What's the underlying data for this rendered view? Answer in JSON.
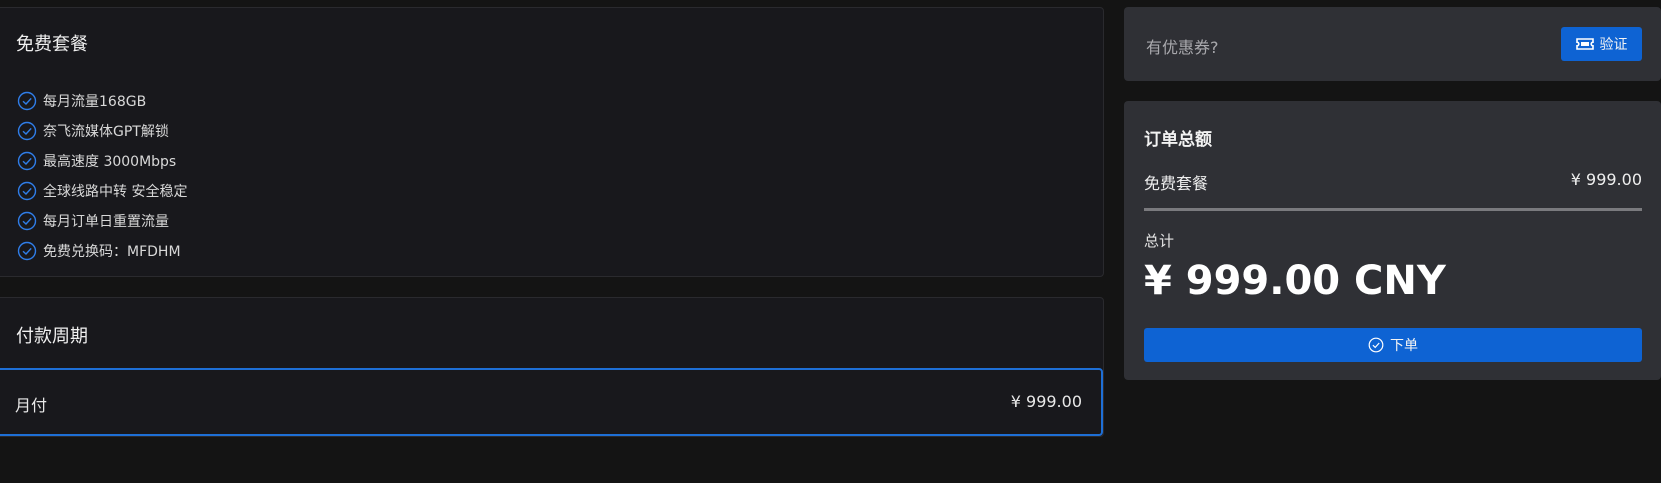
{
  "plan": {
    "title": "免费套餐",
    "features": [
      "每月流量168GB",
      "奈飞流媒体GPT解锁",
      "最高速度 3000Mbps",
      "全球线路中转 安全稳定",
      "每月订单日重置流量",
      "免费兑换码：MFDHM"
    ],
    "feature_icon": "check-circle-icon"
  },
  "billing": {
    "title": "付款周期",
    "option": {
      "label": "月付",
      "price": "¥ 999.00"
    }
  },
  "coupon": {
    "prompt": "有优惠券?",
    "button_label": "验证",
    "button_icon": "ticket-icon"
  },
  "summary": {
    "heading": "订单总额",
    "line_label": "免费套餐",
    "line_price": "¥ 999.00",
    "total_label": "总计",
    "total_amount": "¥ 999.00 CNY",
    "order_button": "下单",
    "order_icon": "check-circle-icon"
  },
  "colors": {
    "accent": "#0e63d3",
    "selected_border": "#1e6fd6",
    "card_bg": "#18181c",
    "panel_bg": "#2f3035",
    "page_bg": "#141414"
  }
}
